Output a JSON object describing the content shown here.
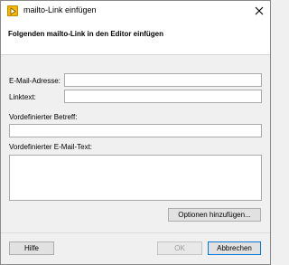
{
  "window": {
    "title": "mailto-Link einfügen",
    "icon": "app-icon"
  },
  "header": {
    "title": "Folgenden mailto-Link in den Editor einfügen"
  },
  "form": {
    "email_label": "E-Mail-Adresse:",
    "email_value": "",
    "linktext_label": "Linktext:",
    "linktext_value": "",
    "subject_label": "Vordefinierter Betreff:",
    "subject_value": "",
    "body_label": "Vordefinierter E-Mail-Text:",
    "body_value": ""
  },
  "buttons": {
    "options": "Optionen hinzufügen...",
    "help": "Hilfe",
    "ok": "OK",
    "cancel": "Abbrechen"
  }
}
